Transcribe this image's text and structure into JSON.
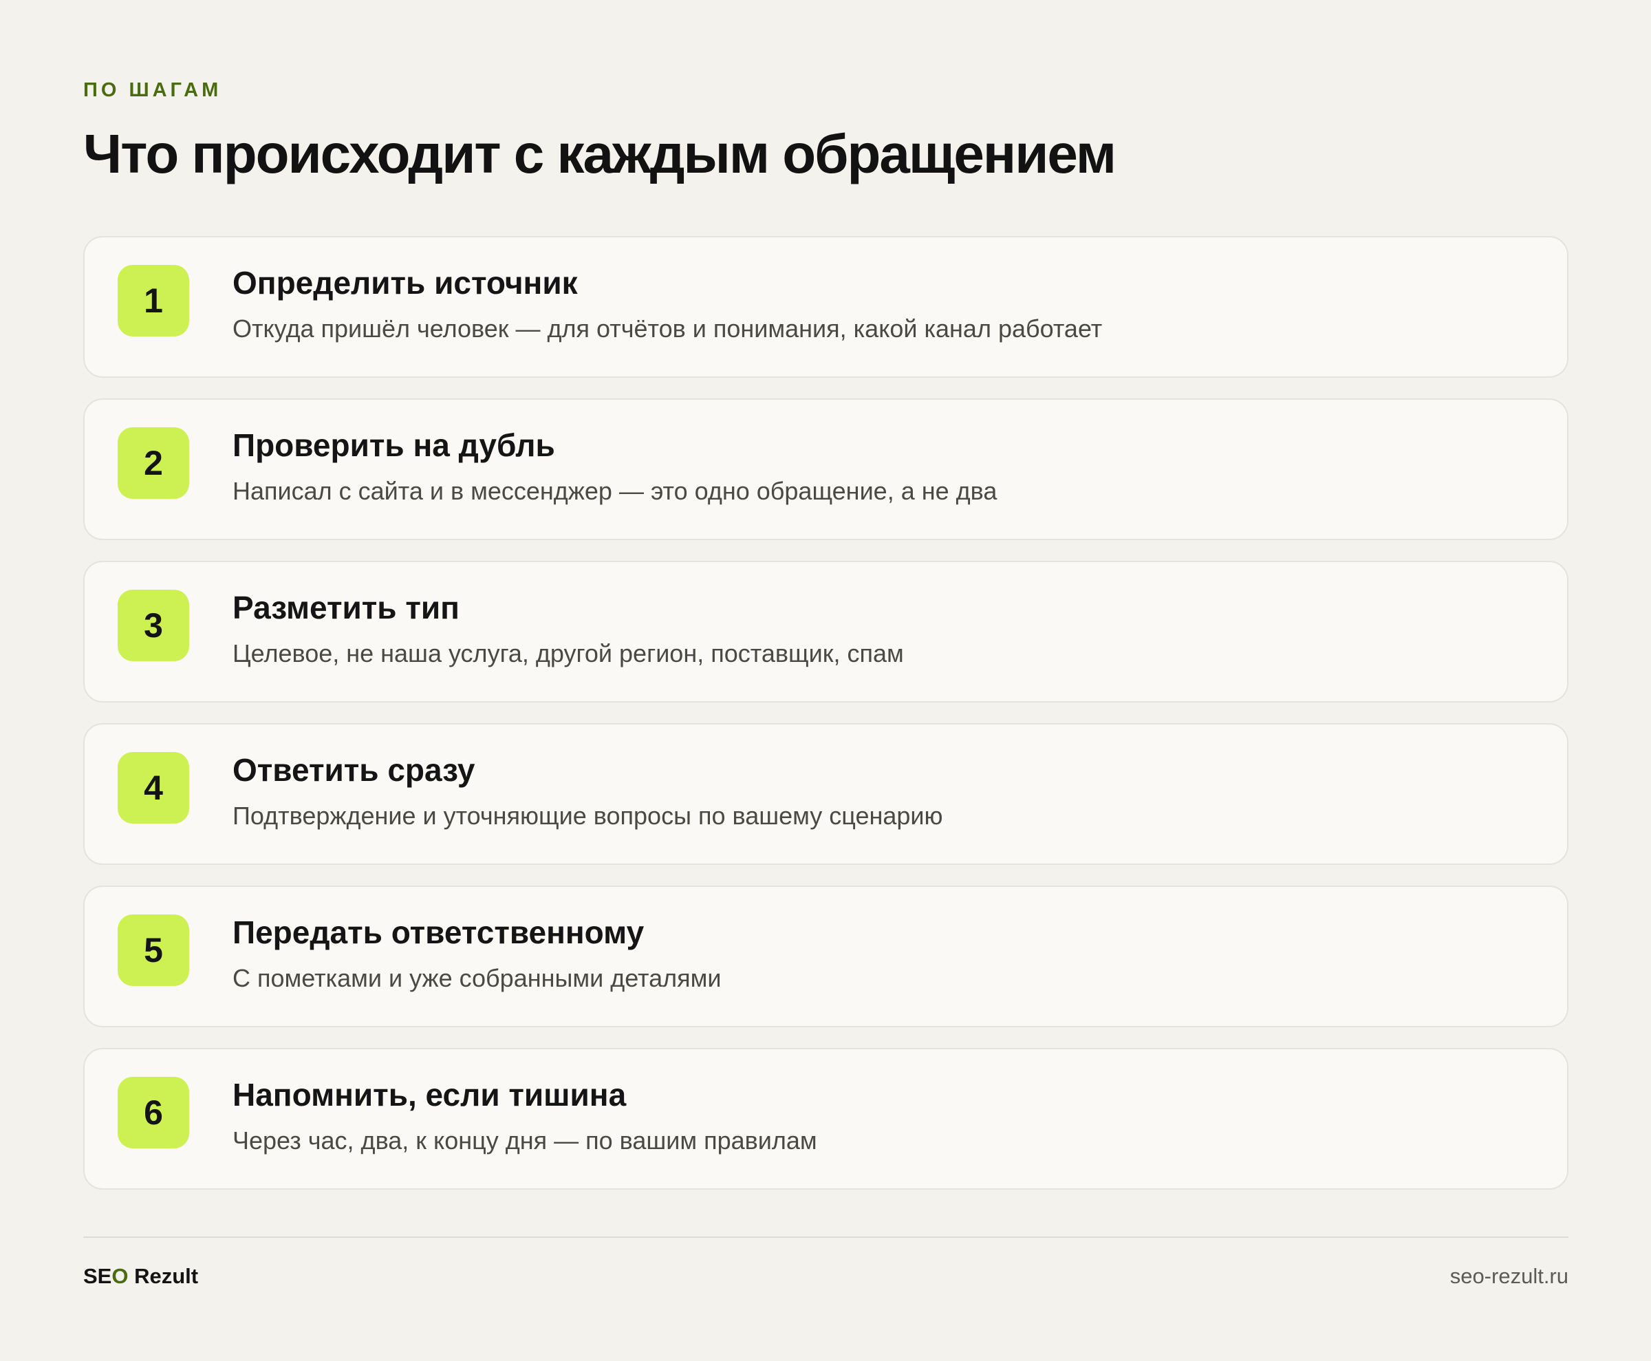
{
  "header": {
    "eyebrow": "ПО ШАГАМ",
    "title": "Что происходит с каждым обращением"
  },
  "steps": [
    {
      "number": "1",
      "title": "Определить источник",
      "description": "Откуда пришёл человек — для отчётов и понимания, какой канал работает"
    },
    {
      "number": "2",
      "title": "Проверить на дубль",
      "description": "Написал с сайта и в мессенджер — это одно обращение, а не два"
    },
    {
      "number": "3",
      "title": "Разметить тип",
      "description": "Целевое, не наша услуга, другой регион, поставщик, спам"
    },
    {
      "number": "4",
      "title": "Ответить сразу",
      "description": "Подтверждение и уточняющие вопросы по вашему сценарию"
    },
    {
      "number": "5",
      "title": "Передать ответственному",
      "description": "С пометками и уже собранными деталями"
    },
    {
      "number": "6",
      "title": "Напомнить, если тишина",
      "description": "Через час, два, к концу дня — по вашим правилам"
    }
  ],
  "footer": {
    "brand_part1": "SE",
    "brand_accent": "O",
    "brand_part2": " Rezult",
    "site": "seo-rezult.ru"
  },
  "colors": {
    "background": "#f3f2ec",
    "card": "#faf9f5",
    "badge": "#cdf152",
    "accent": "#4a6b10"
  }
}
